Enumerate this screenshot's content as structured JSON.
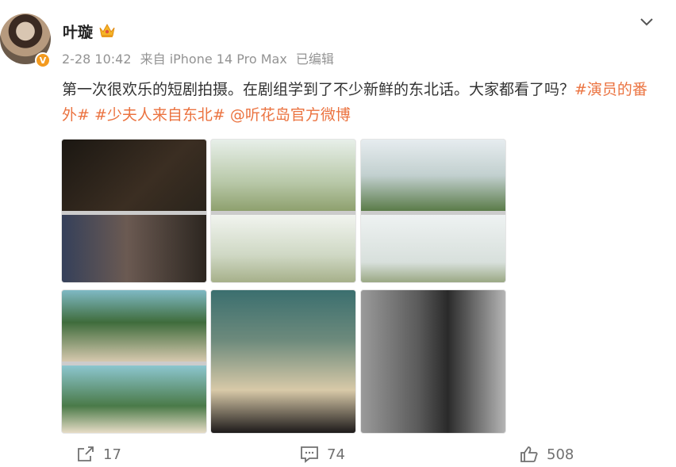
{
  "post": {
    "username": "叶璇",
    "verified_badge": "V",
    "timestamp": "2-28 10:42",
    "source": "来自 iPhone 14 Pro Max",
    "edited": "已编辑",
    "text_plain": "第一次很欢乐的短剧拍摄。在剧组学到了不少新鲜的东北话。大家都看了吗？",
    "tag1": "#演员的番外#",
    "tag2": "#少夫人来自东北#",
    "mention": "@听花岛官方微博",
    "colors": {
      "link": "#eb7340",
      "meta": "#939393",
      "badge": "#f39a1f"
    },
    "icons": [
      "crown-icon",
      "chevron-down-icon",
      "repost-icon",
      "comment-icon",
      "like-icon"
    ]
  },
  "actions": {
    "repost_count": "17",
    "comment_count": "74",
    "like_count": "508"
  }
}
